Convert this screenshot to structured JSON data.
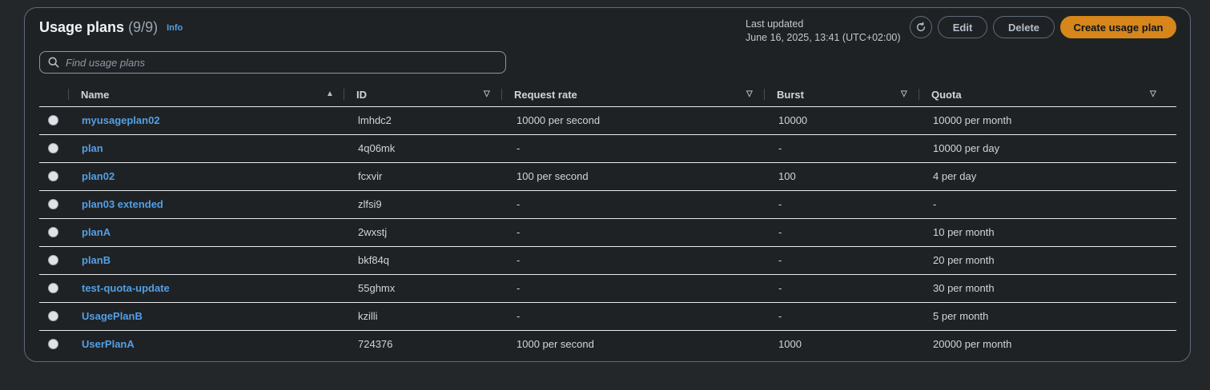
{
  "header": {
    "title": "Usage plans",
    "count": "(9/9)",
    "info": "Info",
    "last_updated_label": "Last updated",
    "last_updated_value": "June 16, 2025, 13:41 (UTC+02:00)"
  },
  "buttons": {
    "edit": "Edit",
    "delete": "Delete",
    "create": "Create usage plan"
  },
  "search": {
    "placeholder": "Find usage plans"
  },
  "columns": [
    "Name",
    "ID",
    "Request rate",
    "Burst",
    "Quota"
  ],
  "rows": [
    {
      "name": "myusageplan02",
      "id": "lmhdc2",
      "rate": "10000 per second",
      "burst": "10000",
      "quota": "10000 per month"
    },
    {
      "name": "plan",
      "id": "4q06mk",
      "rate": "-",
      "burst": "-",
      "quota": "10000 per day"
    },
    {
      "name": "plan02",
      "id": "fcxvir",
      "rate": "100 per second",
      "burst": "100",
      "quota": "4 per day"
    },
    {
      "name": "plan03 extended",
      "id": "zlfsi9",
      "rate": "-",
      "burst": "-",
      "quota": "-"
    },
    {
      "name": "planA",
      "id": "2wxstj",
      "rate": "-",
      "burst": "-",
      "quota": "10 per month"
    },
    {
      "name": "planB",
      "id": "bkf84q",
      "rate": "-",
      "burst": "-",
      "quota": "20 per month"
    },
    {
      "name": "test-quota-update",
      "id": "55ghmx",
      "rate": "-",
      "burst": "-",
      "quota": "30 per month"
    },
    {
      "name": "UsagePlanB",
      "id": "kzilli",
      "rate": "-",
      "burst": "-",
      "quota": "5 per month"
    },
    {
      "name": "UserPlanA",
      "id": "724376",
      "rate": "1000 per second",
      "burst": "1000",
      "quota": "20000 per month"
    }
  ],
  "icons": {
    "refresh": "refresh-icon",
    "search": "search-icon",
    "sort_asc": "sort-ascending-icon",
    "sort": "sort-descending-icon"
  },
  "colors": {
    "accent": "#d6861a",
    "link": "#539fe5",
    "background": "#232729"
  }
}
